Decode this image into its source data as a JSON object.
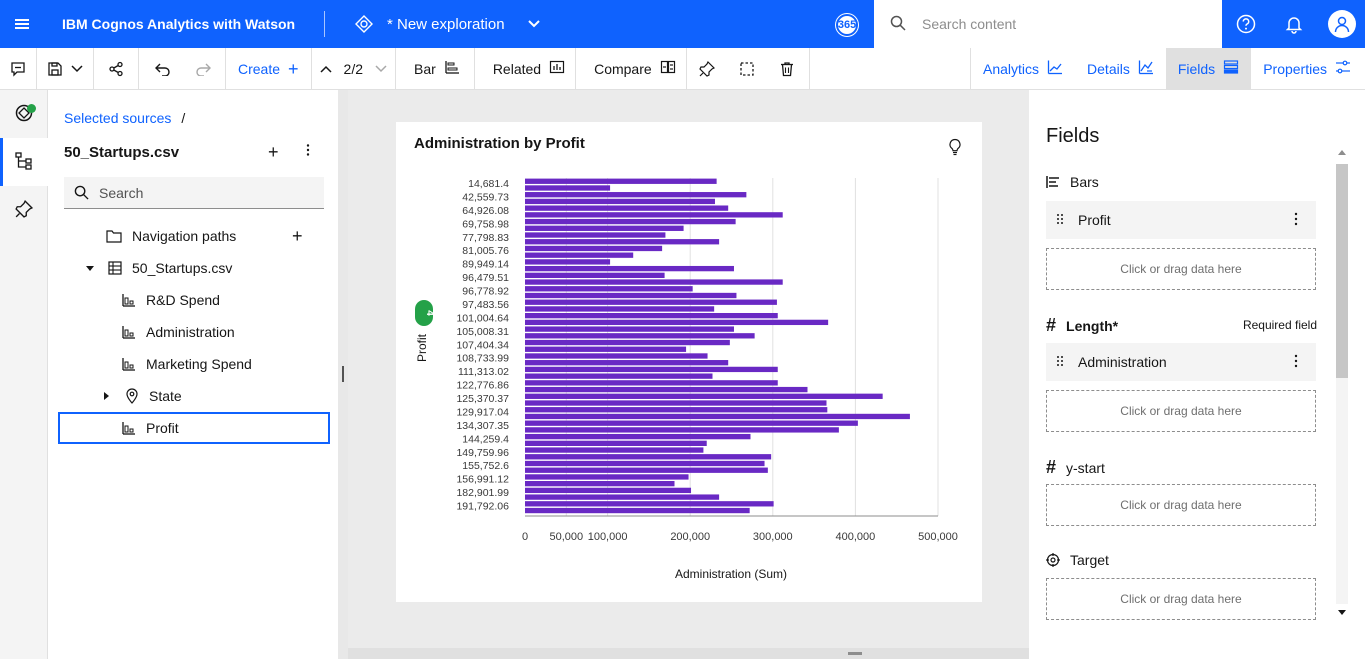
{
  "topbar": {
    "app_title": "IBM Cognos Analytics with Watson",
    "exploration_title": "* New exploration",
    "count_badge": "365",
    "search_placeholder": "Search content"
  },
  "toolbar": {
    "create_label": "Create",
    "pager": "2/2",
    "bar_label": "Bar",
    "related_label": "Related",
    "compare_label": "Compare",
    "tabs": {
      "analytics": "Analytics",
      "details": "Details",
      "fields": "Fields",
      "properties": "Properties"
    }
  },
  "sources": {
    "breadcrumb": "Selected sources",
    "breadcrumb_sep": "/",
    "title": "50_Startups.csv",
    "search_placeholder": "Search",
    "tree": {
      "navigation_paths": "Navigation paths",
      "file": "50_Startups.csv",
      "rd_spend": "R&D Spend",
      "administration": "Administration",
      "marketing_spend": "Marketing Spend",
      "state": "State",
      "profit": "Profit"
    }
  },
  "chart_data": {
    "type": "bar",
    "orientation": "horizontal",
    "title": "Administration by Profit",
    "xlabel": "Administration (Sum)",
    "ylabel": "Profit",
    "y_badge": "4",
    "xlim": [
      0,
      500000
    ],
    "x_ticks": [
      "0",
      "50,000",
      "100,000",
      "200,000",
      "300,000",
      "400,000",
      "500,000"
    ],
    "x_tick_values": [
      0,
      50000,
      100000,
      200000,
      300000,
      400000,
      500000
    ],
    "grid": true,
    "bar_color": "#6929c4",
    "category_labels": [
      "14,681.4",
      "42,559.73",
      "64,926.08",
      "69,758.98",
      "77,798.83",
      "81,005.76",
      "89,949.14",
      "96,479.51",
      "96,778.92",
      "97,483.56",
      "101,004.64",
      "105,008.31",
      "107,404.34",
      "108,733.99",
      "111,313.02",
      "122,776.86",
      "125,370.37",
      "129,917.04",
      "134,307.35",
      "144,259.4",
      "149,759.96",
      "155,752.6",
      "156,991.12",
      "182,901.99",
      "191,792.06"
    ],
    "values": [
      232000,
      103000,
      268000,
      230000,
      246000,
      312000,
      255000,
      192000,
      170000,
      235000,
      166000,
      131000,
      103000,
      253000,
      169000,
      312000,
      203000,
      256000,
      305000,
      229000,
      306000,
      367000,
      253000,
      278000,
      248000,
      195000,
      221000,
      246000,
      306000,
      227000,
      306000,
      342000,
      433000,
      365000,
      366000,
      466000,
      403000,
      380000,
      273000,
      220000,
      216000,
      298000,
      290000,
      294000,
      198000,
      181000,
      201000,
      235000,
      301000,
      272000
    ]
  },
  "fields_panel": {
    "title": "Fields",
    "bars_label": "Bars",
    "bars_field": "Profit",
    "length_label": "Length*",
    "required_label": "Required field",
    "length_field": "Administration",
    "ystart_label": "y-start",
    "target_label": "Target",
    "drop_text": "Click or drag data here"
  }
}
